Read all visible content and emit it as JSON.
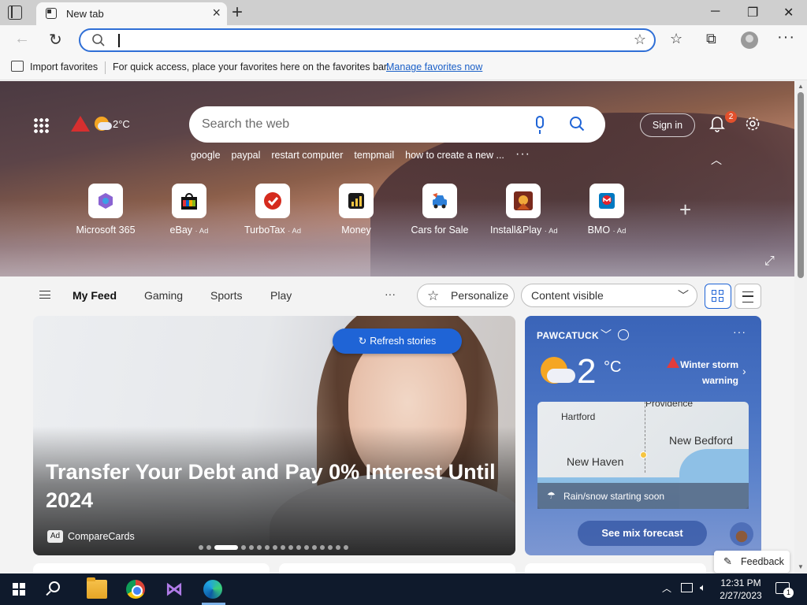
{
  "browser": {
    "tab_title": "New tab",
    "favorites_bar": {
      "import_label": "Import favorites",
      "message": "For quick access, place your favorites here on the favorites bar.",
      "manage_link": "Manage favorites now"
    }
  },
  "hero": {
    "temperature": "2°C",
    "search_placeholder": "Search the web",
    "trending": [
      "google",
      "paypal",
      "restart computer",
      "tempmail",
      "how to create a new ..."
    ],
    "signin_label": "Sign in",
    "notification_count": "2",
    "quick_links": [
      {
        "label": "Microsoft 365",
        "ad": ""
      },
      {
        "label": "eBay",
        "ad": "· Ad"
      },
      {
        "label": "TurboTax",
        "ad": "· Ad"
      },
      {
        "label": "Money",
        "ad": ""
      },
      {
        "label": "Cars for Sale",
        "ad": ""
      },
      {
        "label": "Install&Play",
        "ad": "· Ad"
      },
      {
        "label": "BMO",
        "ad": "· Ad"
      }
    ]
  },
  "feed_nav": {
    "tabs": [
      "My Feed",
      "Gaming",
      "Sports",
      "Play"
    ],
    "active_tab": "My Feed",
    "personalize_label": "Personalize",
    "content_select_value": "Content visible"
  },
  "story": {
    "refresh_label": "Refresh stories",
    "title": "Transfer Your Debt and Pay 0% Interest Until 2024",
    "ad_tag": "Ad",
    "source": "CompareCards",
    "slide_count": 17,
    "active_slide": 2
  },
  "weather": {
    "location": "PAWCATUCK",
    "temperature": "2",
    "unit": "°C",
    "alert": "Winter storm warning",
    "map_labels": {
      "hartford": "Hartford",
      "providence": "Providence",
      "new_bedford": "New Bedford",
      "new_haven": "New Haven"
    },
    "precip_note": "Rain/snow starting soon",
    "forecast_button": "See mix forecast"
  },
  "feedback_label": "Feedback",
  "taskbar": {
    "time": "12:31 PM",
    "date": "2/27/2023",
    "notification_count": "1"
  },
  "colors": {
    "accent": "#1f64d6",
    "alert": "#d72f2f",
    "taskbar": "#0f1a2c"
  }
}
